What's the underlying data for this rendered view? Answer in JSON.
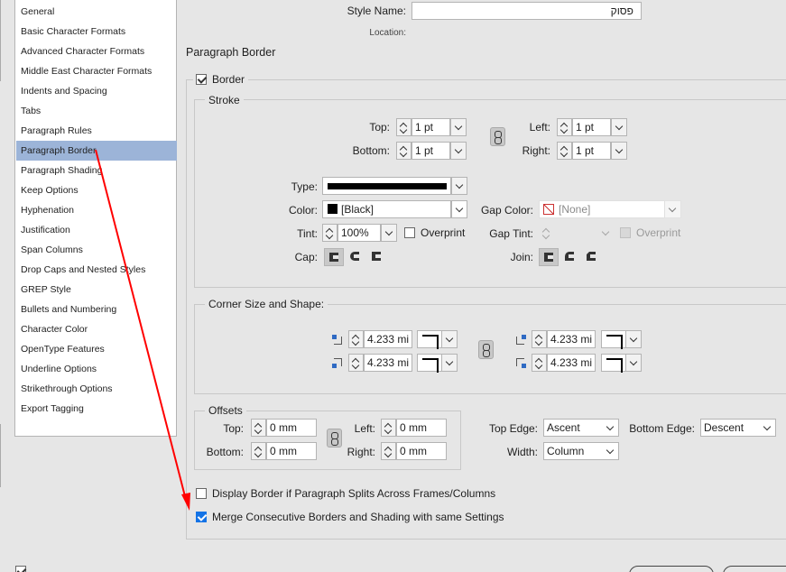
{
  "sidebar": {
    "items": [
      {
        "label": "General"
      },
      {
        "label": "Basic Character Formats"
      },
      {
        "label": "Advanced Character Formats"
      },
      {
        "label": "Middle East Character Formats"
      },
      {
        "label": "Indents and Spacing"
      },
      {
        "label": "Tabs"
      },
      {
        "label": "Paragraph Rules"
      },
      {
        "label": "Paragraph Border"
      },
      {
        "label": "Paragraph Shading"
      },
      {
        "label": "Keep Options"
      },
      {
        "label": "Hyphenation"
      },
      {
        "label": "Justification"
      },
      {
        "label": "Span Columns"
      },
      {
        "label": "Drop Caps and Nested Styles"
      },
      {
        "label": "GREP Style"
      },
      {
        "label": "Bullets and Numbering"
      },
      {
        "label": "Character Color"
      },
      {
        "label": "OpenType Features"
      },
      {
        "label": "Underline Options"
      },
      {
        "label": "Strikethrough Options"
      },
      {
        "label": "Export Tagging"
      }
    ],
    "selected": "Paragraph Border"
  },
  "header": {
    "style_name_label": "Style Name:",
    "style_name_value": "פסוק",
    "location_label": "Location:"
  },
  "section_title": "Paragraph Border",
  "border": {
    "label": "Border",
    "checked": true
  },
  "stroke": {
    "title": "Stroke",
    "top": {
      "label": "Top:",
      "value": "1 pt"
    },
    "bottom": {
      "label": "Bottom:",
      "value": "1 pt"
    },
    "left": {
      "label": "Left:",
      "value": "1 pt"
    },
    "right": {
      "label": "Right:",
      "value": "1 pt"
    },
    "type_label": "Type:",
    "color": {
      "label": "Color:",
      "value": "[Black]"
    },
    "gap_color": {
      "label": "Gap Color:",
      "value": "[None]"
    },
    "tint": {
      "label": "Tint:",
      "value": "100%"
    },
    "overprint": "Overprint",
    "gap_tint_label": "Gap Tint:",
    "gap_overprint": "Overprint",
    "cap_label": "Cap:",
    "join_label": "Join:"
  },
  "corner": {
    "title": "Corner Size and Shape:",
    "values": [
      "4.233 mi",
      "4.233 mi",
      "4.233 mi",
      "4.233 mi"
    ]
  },
  "offsets": {
    "title": "Offsets",
    "top": {
      "label": "Top:",
      "value": "0 mm"
    },
    "bottom": {
      "label": "Bottom:",
      "value": "0 mm"
    },
    "left": {
      "label": "Left:",
      "value": "0 mm"
    },
    "right": {
      "label": "Right:",
      "value": "0 mm"
    }
  },
  "edges": {
    "top_edge": {
      "label": "Top Edge:",
      "value": "Ascent"
    },
    "bottom_edge": {
      "label": "Bottom Edge:",
      "value": "Descent"
    },
    "width": {
      "label": "Width:",
      "value": "Column"
    }
  },
  "options": {
    "display_split": {
      "label": "Display Border if Paragraph Splits Across Frames/Columns",
      "checked": false
    },
    "merge": {
      "label": "Merge Consecutive Borders and Shading with same Settings",
      "checked": true
    }
  },
  "colors": {
    "selection": "#9cb4d8",
    "accent": "#1473e6",
    "annotation_arrow": "#ff0000"
  }
}
